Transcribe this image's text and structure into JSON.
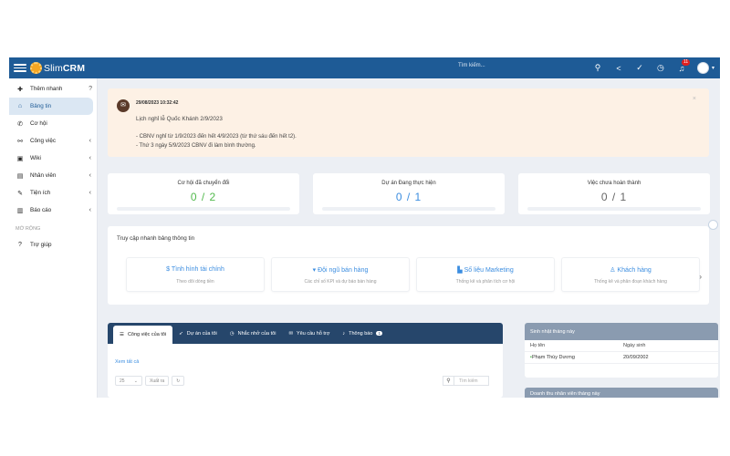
{
  "topbar": {
    "brand_prefix": "Slim",
    "brand_suffix": "CRM",
    "search_placeholder": "Tìm kiếm...",
    "notification_count": "11"
  },
  "sidebar": {
    "quick_add": "Thêm nhanh",
    "items": [
      {
        "label": "Bảng tin",
        "icon": "home-icon",
        "active": true
      },
      {
        "label": "Cơ hội",
        "icon": "phone-icon"
      },
      {
        "label": "Công việc",
        "icon": "handshake-icon"
      },
      {
        "label": "Wiki",
        "icon": "book-icon"
      },
      {
        "label": "Nhân viên",
        "icon": "id-card-icon"
      },
      {
        "label": "Tiện ích",
        "icon": "wrench-icon"
      },
      {
        "label": "Báo cáo",
        "icon": "chart-icon"
      }
    ],
    "section_label": "MỞ RỘNG",
    "help": "Trợ giúp"
  },
  "notice": {
    "time": "29/08/2023 10:32:42",
    "title": "Lịch nghỉ lễ Quốc Khánh 2/9/2023",
    "line1": "- CBNV nghỉ từ 1/9/2023 đến hết 4/9/2023 (từ thứ sáu đến hết t2).",
    "line2": "- Thứ 3 ngày 5/9/2023 CBNV đi làm bình thường."
  },
  "stats": [
    {
      "label": "Cơ hội đã chuyển đổi",
      "value": "0 / 2",
      "color": "#52b94d"
    },
    {
      "label": "Dự án Đang thực hiện",
      "value": "0 / 1",
      "color": "#3b8de0"
    },
    {
      "label": "Việc chưa hoàn thành",
      "value": "0 / 1",
      "color": "#666666"
    }
  ],
  "quick_access": {
    "title": "Truy cập nhanh bảng thông tin",
    "cards": [
      {
        "title": "$ Tình hình tài chính",
        "subtitle": "Theo dõi dòng tiền"
      },
      {
        "title": "Đội ngũ bán hàng",
        "subtitle": "Các chỉ số KPI và dự báo bán hàng"
      },
      {
        "title": "Số liệu Marketing",
        "subtitle": "Thống kê và phân tích cơ hội"
      },
      {
        "title": "Khách hàng",
        "subtitle": "Thống kê và phân đoạn khách hàng"
      }
    ]
  },
  "tasks": {
    "tabs": [
      {
        "label": "Công việc của tôi"
      },
      {
        "label": "Dự án của tôi"
      },
      {
        "label": "Nhắc nhở của tôi"
      },
      {
        "label": "Yêu cầu hỗ trợ"
      },
      {
        "label": "Thông báo",
        "badge": "1"
      }
    ],
    "see_all": "Xem tất cả",
    "page_size": "25",
    "export": "Xuất ra",
    "search_placeholder": "Tìm kiếm"
  },
  "birthdays": {
    "title": "Sinh nhật tháng này",
    "col_name": "Họ tên",
    "col_date": "Ngày sinh",
    "rows": [
      {
        "name": "Phạm Thùy Dương",
        "date": "20/09/2002"
      }
    ]
  },
  "revenue": {
    "title": "Doanh thu nhân viên tháng này"
  }
}
